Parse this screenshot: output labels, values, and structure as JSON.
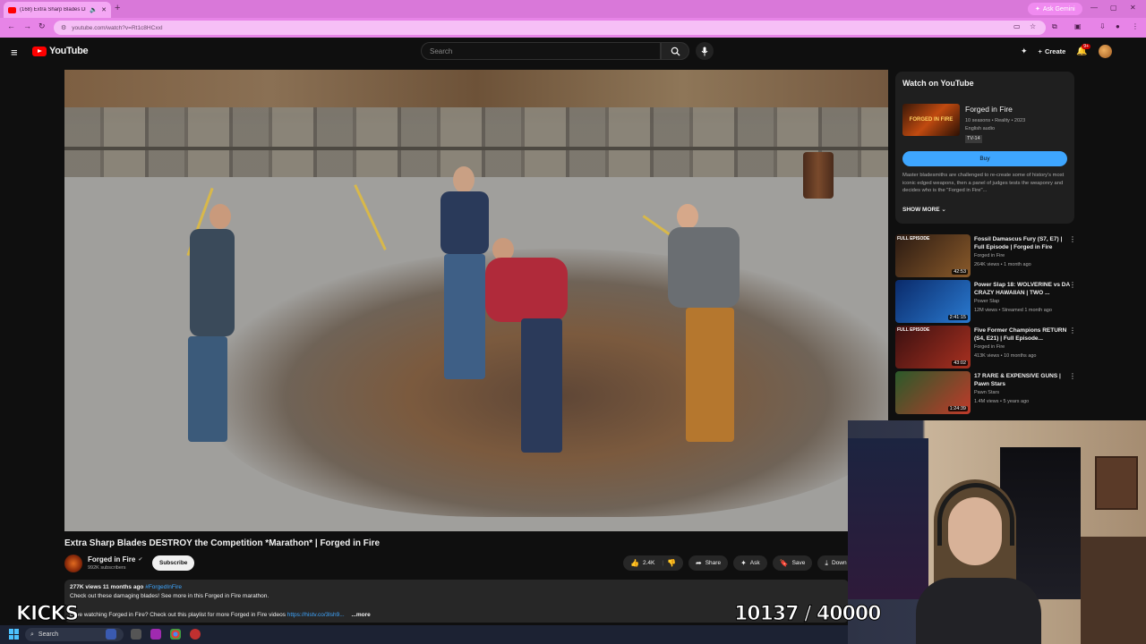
{
  "browser": {
    "tab_title": "(168) Extra Sharp Blades DE...",
    "ask_gemini": "Ask Gemini",
    "url": "youtube.com/watch?v=Rt1c8HCxxI"
  },
  "youtube": {
    "logo_text": "YouTube",
    "search_placeholder": "Search",
    "create_label": "Create",
    "notification_count": "9+"
  },
  "video": {
    "title": "Extra Sharp Blades DESTROY the Competition *Marathon* | Forged in Fire",
    "channel_name": "Forged in Fire",
    "subscribers": "992K subscribers",
    "subscribe_label": "Subscribe",
    "likes": "2.4K",
    "share_label": "Share",
    "ask_label": "Ask",
    "save_label": "Save",
    "download_label": "Down",
    "description": {
      "views": "277K views",
      "age": "11 months ago",
      "hashtag": "#ForgedInFire",
      "line1": "Check out these damaging blades! See more in this Forged in Fire marathon.",
      "line2_prefix": "Love watching Forged in Fire? Check out this playlist for more Forged in Fire videos",
      "link": "https://histv.co/3lsh9...",
      "more": "...more"
    }
  },
  "watch_card": {
    "heading": "Watch on YouTube",
    "show_title": "Forged in Fire",
    "thumb_text": "FORGED IN FIRE",
    "meta_line1": "10 seasons • Reality • 2023",
    "meta_line2": "English audio",
    "rating": "TV-14",
    "buy_label": "Buy",
    "description": "Master bladesmiths are challenged to re-create some of history's most iconic edged weapons, then a panel of judges tests the weaponry and decides who is the \"Forged in Fire\"...",
    "show_more": "SHOW MORE"
  },
  "recommendations": [
    {
      "title": "Fossil Damascus Fury (S7, E7) | Full Episode | Forged in Fire",
      "channel": "Forged in Fire",
      "meta": "264K views • 1 month ago",
      "duration": "42:53",
      "badge": "FULL EPISODE",
      "colors": [
        "#2a1a12",
        "#8a5a2a"
      ]
    },
    {
      "title": "Power Slap 18: WOLVERINE vs DA CRAZY HAWAIIAN | TWO ...",
      "channel": "Power Slap",
      "meta": "12M views • Streamed 1 month ago",
      "duration": "2:41:15",
      "badge": "",
      "colors": [
        "#0a2a6a",
        "#2a7ad0"
      ]
    },
    {
      "title": "Five Former Champions RETURN (S4, E21) | Full Episode...",
      "channel": "Forged in Fire",
      "meta": "413K views • 10 months ago",
      "duration": "43:02",
      "badge": "FULL EPISODE",
      "colors": [
        "#3a1010",
        "#a83020"
      ]
    },
    {
      "title": "17 RARE & EXPENSIVE GUNS | Pawn Stars",
      "channel": "Pawn Stars",
      "meta": "1.4M views • 5 years ago",
      "duration": "1:24:39",
      "badge": "",
      "colors": [
        "#2a5a2a",
        "#c03a2a"
      ]
    }
  ],
  "overlay": {
    "kicks_label": "KICKS",
    "counter": "10137 / 40000"
  },
  "taskbar": {
    "search_label": "Search"
  }
}
